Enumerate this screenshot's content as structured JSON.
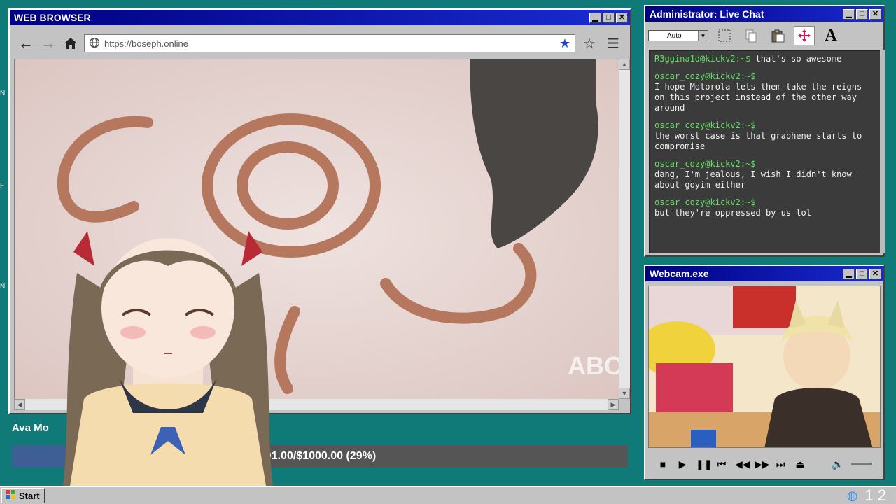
{
  "browser": {
    "title": "WEB BROWSER",
    "url": "https://boseph.online",
    "buttons": {
      "minimize": "▁",
      "maximize": "□",
      "close": "✕"
    }
  },
  "chat": {
    "title": "Administrator: Live Chat",
    "zoom_value": "Auto",
    "messages": [
      {
        "user": "R3ggina1d@kickv2:~$",
        "text": "that's so awesome",
        "inline": true
      },
      {
        "user": "oscar_cozy@kickv2:~$",
        "text": "I hope Motorola lets them take the reigns on this project instead of the other way around"
      },
      {
        "user": "oscar_cozy@kickv2:~$",
        "text": "the worst case is that graphene starts to compromise"
      },
      {
        "user": "oscar_cozy@kickv2:~$",
        "text": "dang, I'm jealous, I wish I didn't know about goyim either"
      },
      {
        "user": "oscar_cozy@kickv2:~$",
        "text": "but they're oppressed by us lol"
      }
    ]
  },
  "webcam": {
    "title": "Webcam.exe"
  },
  "donation": {
    "name": "Ava Mo",
    "text": "$291.00/$1000.00 (29%)",
    "progress": 0.29
  },
  "taskbar": {
    "start_label": "Start",
    "clock": "1 2"
  },
  "icons": [
    "back-arrow-icon",
    "forward-arrow-icon",
    "home-icon",
    "globe-icon",
    "bookmark-star-icon",
    "favorite-star-icon",
    "menu-icon"
  ]
}
